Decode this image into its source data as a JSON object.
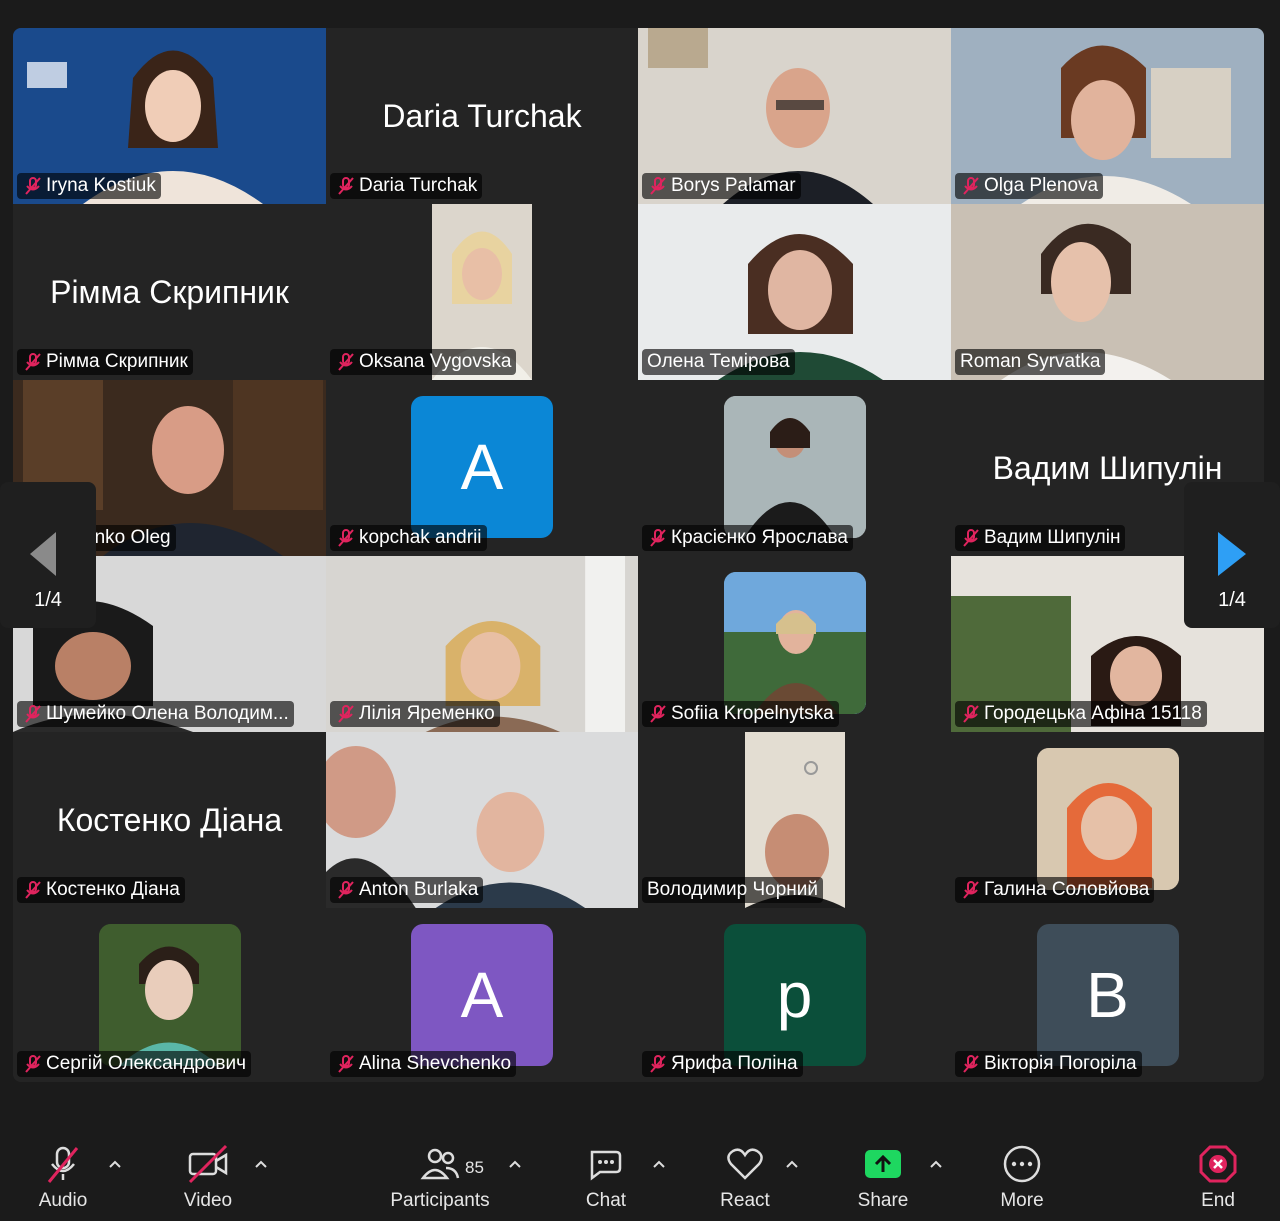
{
  "participants": [
    {
      "name": "Iryna Kostiuk",
      "muted": true
    },
    {
      "name": "Daria Turchak",
      "muted": true,
      "display": "Daria Turchak"
    },
    {
      "name": "Borys Palamar",
      "muted": true
    },
    {
      "name": "Olga Plenova",
      "muted": true
    },
    {
      "name": "Рімма Скрипник",
      "muted": true,
      "display": "Рімма Скрипник"
    },
    {
      "name": "Oksana Vygovska",
      "muted": true
    },
    {
      "name": "Олена Темірова",
      "muted": false,
      "active_speaker": true
    },
    {
      "name": "Roman Syrvatka",
      "muted": false
    },
    {
      "name": "Iremenko Oleg",
      "muted": true
    },
    {
      "name": "kopchak andrii",
      "muted": true,
      "avatar_letter": "A",
      "avatar_color": "#0b87d6"
    },
    {
      "name": "Красієнко Ярослава",
      "muted": true
    },
    {
      "name": "Вадим Шипулін",
      "muted": true,
      "display": "Вадим Шипулін"
    },
    {
      "name": "Шумейко Олена Володим...",
      "muted": true
    },
    {
      "name": "Лілія Яременко",
      "muted": true
    },
    {
      "name": "Sofiia Kropelnytska",
      "muted": true
    },
    {
      "name": "Городецька Афіна 15118",
      "muted": true
    },
    {
      "name": "Костенко Діана",
      "muted": true,
      "display": "Костенко Діана"
    },
    {
      "name": "Anton Burlaka",
      "muted": true
    },
    {
      "name": "Володимир Чорний",
      "muted": false
    },
    {
      "name": "Галина Соловйова",
      "muted": true
    },
    {
      "name": "Сергій Олександрович",
      "muted": true
    },
    {
      "name": "Alina Shevchenko",
      "muted": true,
      "avatar_letter": "A",
      "avatar_color": "#7e57c2"
    },
    {
      "name": "Ярифа Поліна",
      "muted": true,
      "avatar_letter": "p",
      "avatar_color": "#0b4f3a"
    },
    {
      "name": "Вікторія Погоріла",
      "muted": true,
      "avatar_letter": "B",
      "avatar_color": "#3e4d59"
    }
  ],
  "pagination": {
    "prev": "1/4",
    "next": "1/4"
  },
  "toolbar": {
    "audio": "Audio",
    "video": "Video",
    "participants": "Participants",
    "participants_count": "85",
    "chat": "Chat",
    "react": "React",
    "share": "Share",
    "more": "More",
    "end": "End"
  },
  "colors": {
    "active": "#3fd35a",
    "muted": "#e0245e",
    "share": "#1ed760",
    "end": "#e0245e",
    "nav_arrow": "#2e9ff5"
  }
}
